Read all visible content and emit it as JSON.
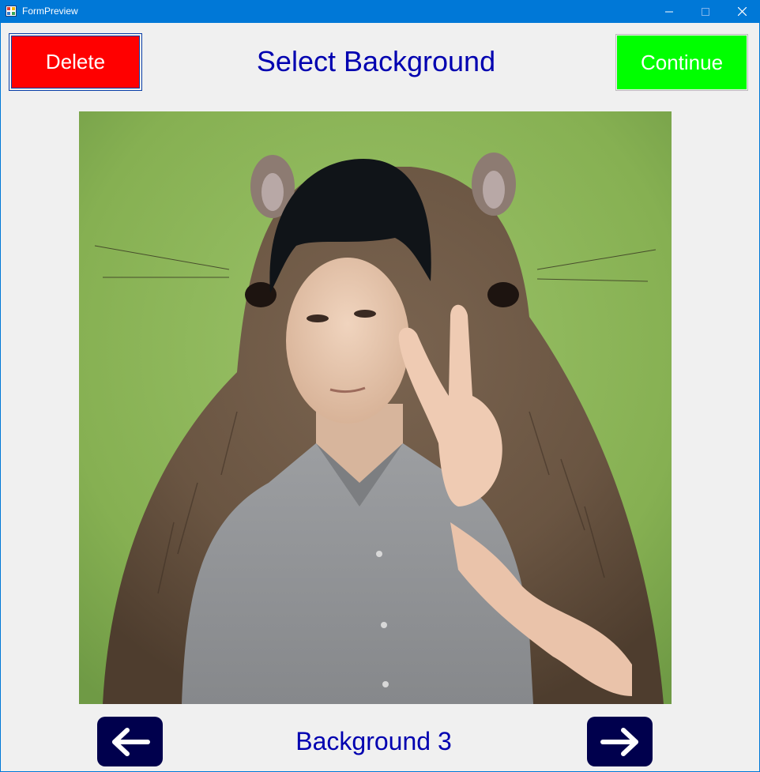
{
  "window": {
    "title": "FormPreview",
    "titlebar_color": "#0078d7"
  },
  "header": {
    "delete_label": "Delete",
    "heading": "Select Background",
    "continue_label": "Continue"
  },
  "preview": {
    "description_icon": "capybara-background-with-person"
  },
  "navigation": {
    "current_label": "Background 3",
    "prev_icon": "arrow-left-icon",
    "next_icon": "arrow-right-icon"
  },
  "colors": {
    "delete": "#ff0000",
    "continue": "#00ff00",
    "heading_text": "#0000b0",
    "nav_button": "#00004d"
  }
}
